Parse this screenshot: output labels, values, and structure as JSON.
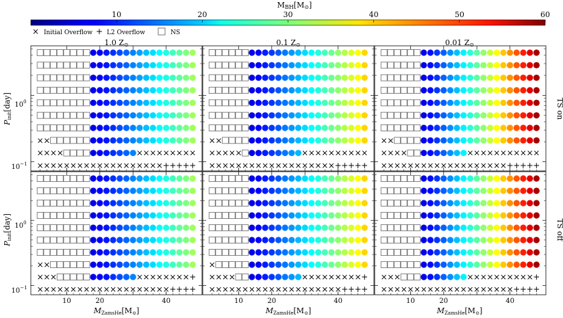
{
  "colorbar": {
    "label": "M_BH[M_⊙]",
    "ticks": [
      "10",
      "20",
      "30",
      "40",
      "50",
      "60"
    ],
    "range": [
      0,
      60
    ]
  },
  "legend": {
    "initial_overflow": "Initial Overflow",
    "l2_overflow": "L2 Overflow",
    "ns": "NS"
  },
  "panel_titles": [
    "1.0 Z",
    "0.1 Z",
    "0.01 Z"
  ],
  "row_labels": [
    "TS on",
    "TS off"
  ],
  "axes": {
    "xlabel_main": "M",
    "xlabel_sub": "ZamsHe",
    "xlabel_unit": "[M",
    "xlabel_close": "]",
    "ylabel_main": "P",
    "ylabel_sub": "init",
    "ylabel_unit": "[day]",
    "xticks": [
      "10",
      "20",
      "40"
    ],
    "ytick_upper": "10",
    "ytick_upper_exp": "0",
    "ytick_lower": "10",
    "ytick_lower_exp": "−1"
  },
  "chart_data": {
    "type": "scatter",
    "x": [
      2,
      4,
      6,
      8,
      10,
      12,
      14,
      16,
      18,
      20,
      22,
      24,
      26,
      28,
      30,
      32,
      34,
      36,
      38,
      40,
      42,
      44,
      46,
      48
    ],
    "y_rows": 10,
    "symbols": "X = initial overflow, + = L2 overflow, N = neutron star, F = black hole (colored by M_BH)",
    "metallicities": [
      "1.0",
      "0.1",
      "0.01"
    ],
    "panels": [
      {
        "ts": "on",
        "z": "1.0",
        "grid": [
          "XXXXXXXXXXXXXXXXXXX+++++",
          "XXXXNNNNFFFFFFFXXXXXXXXX",
          "XXNNNNNNFFFFFFFFFFFFFFFF",
          "NNNNNNNNFFFFFFFFFFFFFFFF",
          "NNNNNNNNFFFFFFFFFFFFFFFF",
          "NNNNNNNNFFFFFFFFFFFFFFFF",
          "NNNNNNNNFFFFFFFFFFFFFFFF",
          "NNNNNNNNFFFFFFFFFFFFFFFF",
          "NNNNNNNNFFFFFFFFFFFFFFFF",
          "NNNNNNNNFFFFFFFFFFFFFFFF"
        ]
      },
      {
        "ts": "on",
        "z": "0.1",
        "grid": [
          "XXXXXXXXXXXXXXXXXXX+++++",
          "XXXXXNFFFFFFFFXXXXXXXXXX",
          "XXNNNNFFFFFFFFFFFFFFFFFF",
          "NNNNNNFFFFFFFFFFFFFFFFFF",
          "NNNNNNFFFFFFFFFFFFFFFFFF",
          "NNNNNNFFFFFFFFFFFFFFFFFF",
          "NNNNNNFFFFFFFFFFFFFFFFFF",
          "NNNNNNFFFFFFFFFFFFFFFFFF",
          "NNNNNNFFFFFFFFFFFFFFFFFF",
          "NNNNNNFFFFFFFFFFFFFFFFFF"
        ]
      },
      {
        "ts": "on",
        "z": "0.01",
        "grid": [
          "XXXXXXXXXXXXXXXXXXX+++++",
          "XXXXNNFFFFFFFXXXXXXXXXXX",
          "XXNNNNFFFFFFFFFFFFFFFFFF",
          "NNNNNNFFFFFFFFFFFFFFFFFF",
          "NNNNNNFFFFFFFFFFFFFFFFFF",
          "NNNNNNFFFFFFFFFFFFFFFFFF",
          "NNNNNNFFFFFFFFFFFFFFFFFF",
          "NNNNNNFFFFFFFFFFFFFFFFFF",
          "NNNNNNFFFFFFFFFFFFFFFFFF",
          "NNNNNNFFFFFFFFFFFFFFFFFF"
        ]
      },
      {
        "ts": "off",
        "z": "1.0",
        "grid": [
          "XXXXXXXXXXXXXXXXXXXX++++",
          "XXXNNNNNFFFFFFFXXXXXXXX+",
          "XXNNNNNNFFFFFFFFFFFFFFFF",
          "NNNNNNNNFFFFFFFFFFFFFFFF",
          "NNNNNNNNFFFFFFFFFFFFFFFF",
          "NNNNNNNNFFFFFFFFFFFFFFFF",
          "NNNNNNNNFFFFFFFFFFFFFFFF",
          "NNNNNNNNFFFFFFFFFFFFFFFF",
          "NNNNNNNNFFFFFFFFFFFFFFFF",
          "NNNNNNNNFFFFFFFFFFFFFFFF"
        ]
      },
      {
        "ts": "off",
        "z": "0.1",
        "grid": [
          "XXXXXXXXXXXXXXXXXXXX++++",
          "XXXXNNFFFFFFFFXXXXXXXXX+",
          "XNNNNNFFFFFFFFFFFFFFFFFF",
          "NNNNNNFFFFFFFFFFFFFFFFFF",
          "NNNNNNFFFFFFFFFFFFFFFFFF",
          "NNNNNNFFFFFFFFFFFFFFFFFF",
          "NNNNNNFFFFFFFFFFFFFFFFFF",
          "NNNNNNFFFFFFFFFFFFFFFFFF",
          "NNNNNNFFFFFFFFFFFFFFFFFF",
          "NNNNNNFFFFFFFFFFFFFFFFFF"
        ]
      },
      {
        "ts": "off",
        "z": "0.01",
        "grid": [
          "XXXXXXXXXXXXXXXXXXXX++++",
          "XXXNNNFFFFFFFXXXXXXXXXX+",
          "NNNNNNFFFFFFFFFFFFFFFFFF",
          "NNNNNNFFFFFFFFFFFFFFFFFF",
          "NNNNNNFFFFFFFFFFFFFFFFFF",
          "NNNNNNFFFFFFFFFFFFFFFFFF",
          "NNNNNNFFFFFFFFFFFFFFFFFF",
          "NNNNNNFFFFFFFFFFFFFFFFFF",
          "NNNNNNFFFFFFFFFFFFFFFFFF",
          "NNNNNNFFFFFFFFFFFFFFFFFF"
        ]
      }
    ],
    "bh_mass_at_max_x": {
      "1.0": 32,
      "0.1": 40,
      "0.01": 58
    },
    "bh_mass_at_min_bh_x": {
      "1.0": 6,
      "0.1": 6,
      "0.01": 6
    }
  }
}
